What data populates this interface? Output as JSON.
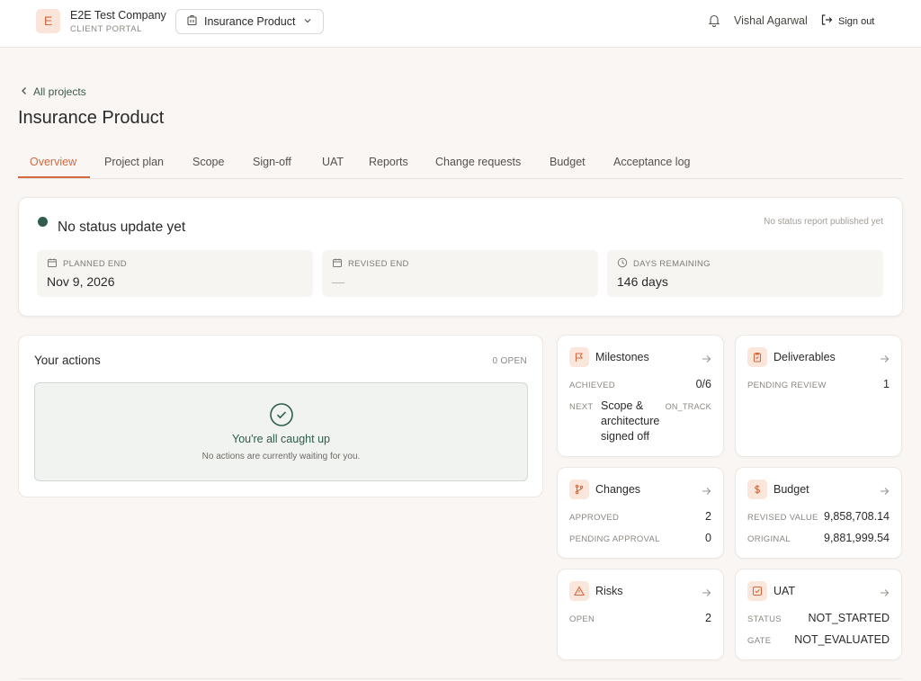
{
  "header": {
    "logo_letter": "E",
    "company_name": "E2E Test Company",
    "portal_label": "CLIENT PORTAL",
    "project_select": "Insurance Product",
    "user_name": "Vishal Agarwal",
    "sign_out": "Sign out"
  },
  "nav": {
    "back_label": "All projects",
    "page_title": "Insurance Product",
    "tabs": [
      "Overview",
      "Project plan",
      "Scope",
      "Sign-off",
      "UAT",
      "Reports",
      "Change requests",
      "Budget",
      "Acceptance log"
    ],
    "active_tab": "Overview"
  },
  "status": {
    "title": "No status update yet",
    "note": "No status report published yet",
    "indicator_color": "#2e5d4b",
    "planned_end_label": "PLANNED END",
    "planned_end_value": "Nov 9, 2026",
    "revised_end_label": "REVISED END",
    "revised_end_value": "—",
    "days_remaining_label": "DAYS REMAINING",
    "days_remaining_value": "146 days"
  },
  "actions": {
    "title": "Your actions",
    "open_count": "0 OPEN",
    "empty_title": "You're all caught up",
    "empty_sub": "No actions are currently waiting for you."
  },
  "milestones": {
    "title": "Milestones",
    "achieved_label": "ACHIEVED",
    "achieved_value": "0/6",
    "next_label": "NEXT",
    "next_text": "Scope & architecture signed off",
    "next_state": "ON_TRACK"
  },
  "deliverables": {
    "title": "Deliverables",
    "pending_label": "PENDING REVIEW",
    "pending_value": "1"
  },
  "changes": {
    "title": "Changes",
    "approved_label": "APPROVED",
    "approved_value": "2",
    "pending_label": "PENDING APPROVAL",
    "pending_value": "0"
  },
  "budget": {
    "title": "Budget",
    "revised_label": "REVISED VALUE",
    "revised_value": "9,858,708.14",
    "original_label": "ORIGINAL",
    "original_value": "9,881,999.54"
  },
  "risks": {
    "title": "Risks",
    "open_label": "OPEN",
    "open_value": "2"
  },
  "uat": {
    "title": "UAT",
    "status_label": "STATUS",
    "status_value": "NOT_STARTED",
    "gate_label": "GATE",
    "gate_value": "NOT_EVALUATED"
  },
  "colors": {
    "accent": "#d2693f",
    "accent_soft": "#fbe6dc",
    "success": "#2e5d4b",
    "background": "#f9f6f3"
  },
  "icons": [
    "building-icon",
    "chevron-down-icon",
    "bell-icon",
    "sign-out-icon",
    "chevron-left-icon",
    "calendar-icon",
    "clock-icon",
    "check-circle-icon",
    "flag-icon",
    "clipboard-icon",
    "git-branch-icon",
    "dollar-icon",
    "warning-icon",
    "checkbox-icon",
    "arrow-right-icon"
  ]
}
